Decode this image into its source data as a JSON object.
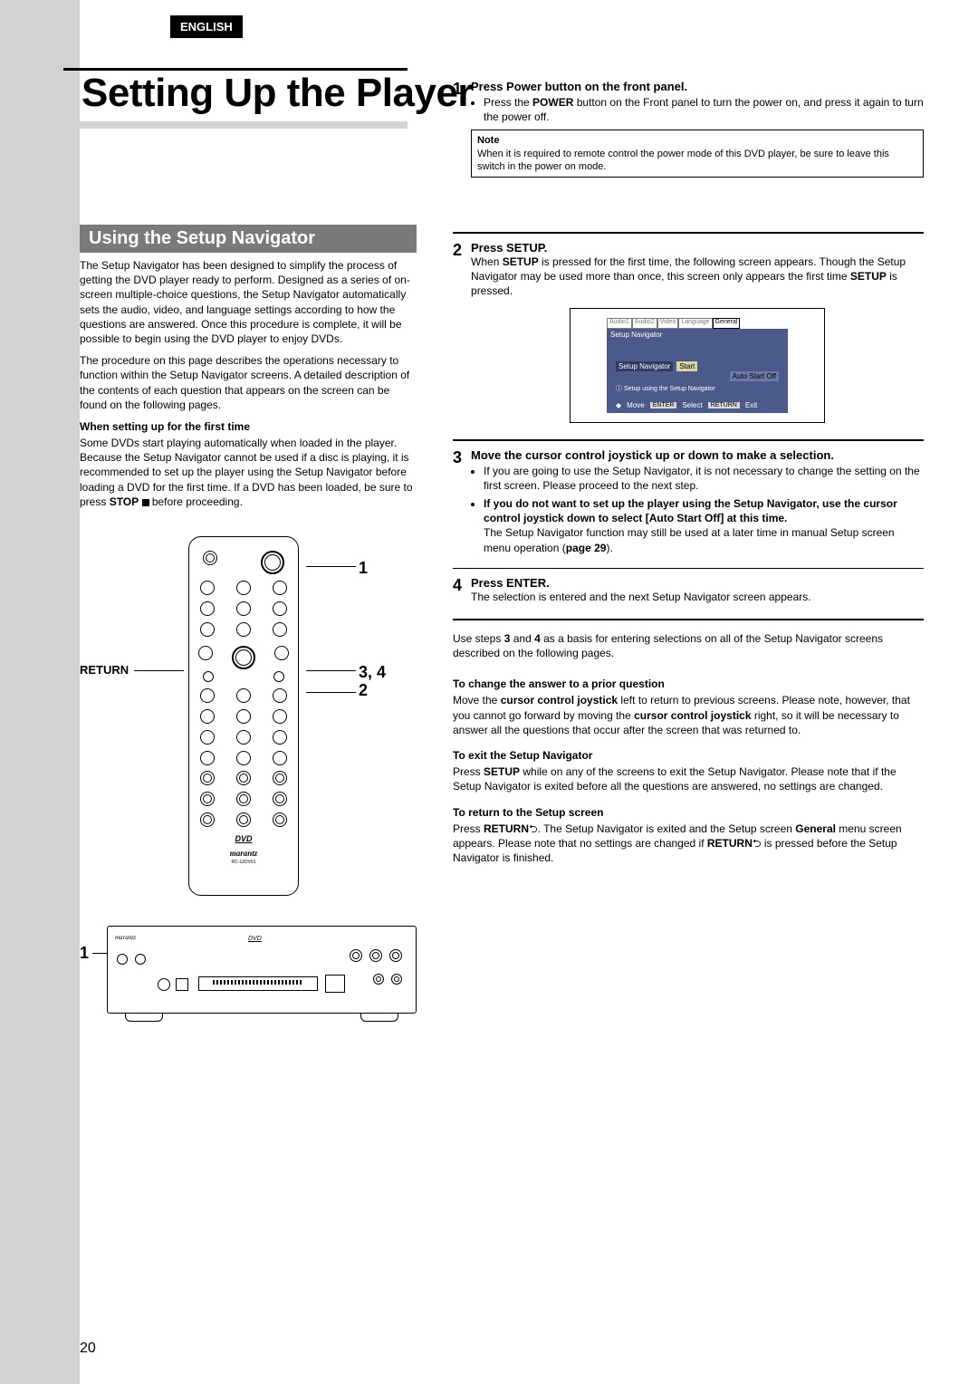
{
  "header": {
    "lang_tab": "ENGLISH"
  },
  "title": "Setting Up the Player",
  "section_bar": "Using the Setup Navigator",
  "intro": {
    "p1": "The Setup Navigator has been designed to simplify the process of getting the DVD player ready to perform. Designed as a series of on-screen multiple-choice questions, the Setup Navigator automatically sets the audio, video, and language settings according to how the questions are answered. Once this procedure is complete, it will be possible to begin using the DVD player to enjoy DVDs.",
    "p2": "The procedure on this page describes the operations necessary to function within the Setup Navigator screens. A detailed description of the contents of each question that appears on the screen can be found on  the following pages."
  },
  "first_time": {
    "heading": "When setting up for the first time",
    "body_a": "Some DVDs start playing automatically when loaded in the player. Because the Setup Navigator cannot be used if a disc is playing, it is recommended to set up the player using the Setup Navigator before loading a DVD for the first time. If a DVD has been loaded, be sure to press ",
    "stop_word": "STOP",
    "body_b": " before proceeding."
  },
  "remote": {
    "return_label": "RETURN",
    "c1": "1",
    "c34": "3, 4",
    "c2": "2",
    "c1b": "1",
    "model": "RC-12DV01",
    "dvd": "DVD",
    "brand": "marantz"
  },
  "step1": {
    "num": "1",
    "title": "Press  Power button on the front panel.",
    "bullet_a": "Press the ",
    "bullet_bold": "POWER",
    "bullet_b": " button on the Front panel to turn the power on, and press it again to turn the power off.",
    "note_label": "Note",
    "note_body": "When it is required to remote control the power mode of this DVD player, be sure to leave this switch in the power on mode."
  },
  "step2": {
    "num": "2",
    "title": "Press SETUP.",
    "p_a": "When ",
    "p_bold1": "SETUP",
    "p_b": " is pressed for the first time, the following screen appears. Though the Setup Navigator may be used more than once, this screen only appears the first time ",
    "p_bold2": "SETUP",
    "p_c": " is pressed."
  },
  "screen": {
    "tabs": [
      "Audio1",
      "Audio2",
      "Video",
      "Language",
      "General"
    ],
    "title": "Setup Navigator",
    "row_label": "Setup Navigator",
    "row_val1": "Start",
    "row_val2": "Auto Start Off",
    "info": "Setup using the Setup Navigator",
    "move": "Move",
    "enter": "ENTER",
    "select": "Select",
    "return": "RETURN",
    "exit": "Exit"
  },
  "step3": {
    "num": "3",
    "title": "Move the cursor control joystick up or down to make a selection.",
    "bullet1": "If you are going to use the Setup Navigator, it is not necessary to change the setting on the first screen. Please proceed to the next step.",
    "bullet2_bold": "If you do not want to set up the player using the Setup Navigator, use the cursor control joystick down to select [Auto Start Off] at this time.",
    "bullet2_tail_a": "The Setup Navigator function may still be used at a later time in manual Setup screen menu operation (",
    "bullet2_tail_bold": "page 29",
    "bullet2_tail_b": ")."
  },
  "step4": {
    "num": "4",
    "title": "Press ENTER.",
    "body": "The selection is entered and the next Setup Navigator screen appears."
  },
  "after": {
    "p_a": "Use steps ",
    "b3": "3",
    "p_b": " and ",
    "b4": "4",
    "p_c": " as a basis for entering selections on all of the Setup Navigator screens described on the following pages."
  },
  "change": {
    "heading": "To change the answer to a prior question",
    "a": "Move the ",
    "bold1": "cursor control joystick",
    "b": " left to return to previous screens. Please note, however, that you cannot go forward by moving the ",
    "bold2": "cursor control joystick",
    "c": " right, so it will be necessary to answer all the questions that occur after the screen that was returned to."
  },
  "exit": {
    "heading": "To exit the Setup Navigator",
    "a": "Press ",
    "bold": "SETUP",
    "b": " while on any of the screens to exit the Setup Navigator. Please note that if the Setup Navigator is exited before all the questions are answered, no settings are changed."
  },
  "return_sect": {
    "heading": "To return to the Setup screen",
    "a": "Press ",
    "bold1": "RETURN",
    "b": ". The Setup Navigator is exited and the Setup screen ",
    "bold2": "General",
    "c": " menu screen appears. Please note that no settings are changed if ",
    "bold3": "RETURN",
    "d": " is pressed before the Setup Navigator is finished."
  },
  "page_number": "20"
}
